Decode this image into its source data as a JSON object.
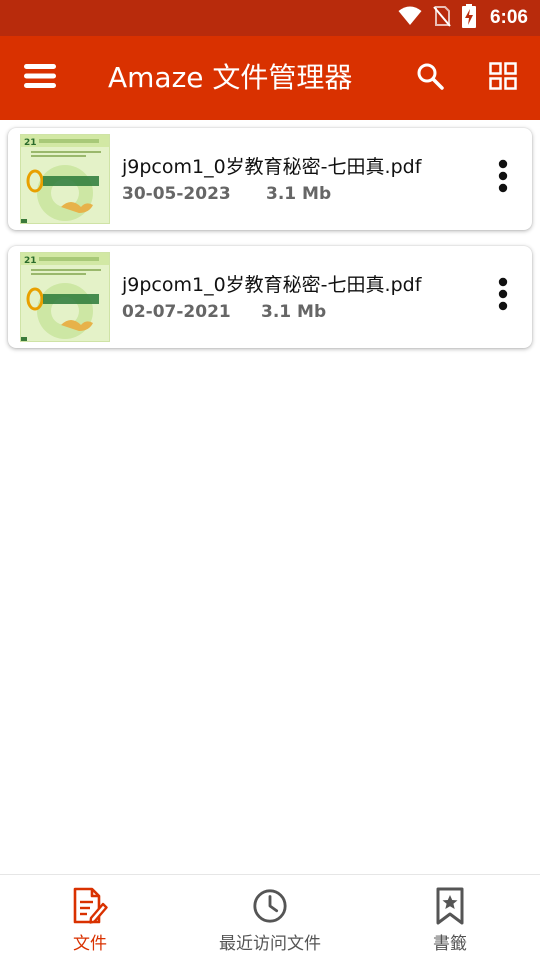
{
  "status_bar": {
    "time": "6:06",
    "icons": [
      "wifi-icon",
      "no-sim-icon",
      "battery-charging-icon"
    ]
  },
  "app_bar": {
    "title": "Amaze 文件管理器",
    "background": "#d93100",
    "icons": [
      "menu-icon",
      "search-icon",
      "grid-view-icon"
    ]
  },
  "files": [
    {
      "name": "j9pcom1_0岁教育秘密-七田真.pdf",
      "date": "30-05-2023",
      "size": "3.1 Mb"
    },
    {
      "name": "j9pcom1_0岁教育秘密-七田真.pdf",
      "date": "02-07-2021",
      "size": "3.1 Mb"
    }
  ],
  "bottom_nav": {
    "items": [
      {
        "label": "文件",
        "icon": "file-edit-icon",
        "active": true
      },
      {
        "label": "最近访问文件",
        "icon": "clock-icon",
        "active": false
      },
      {
        "label": "書籤",
        "icon": "bookmark-star-icon",
        "active": false
      }
    ],
    "active_color": "#d93100"
  }
}
